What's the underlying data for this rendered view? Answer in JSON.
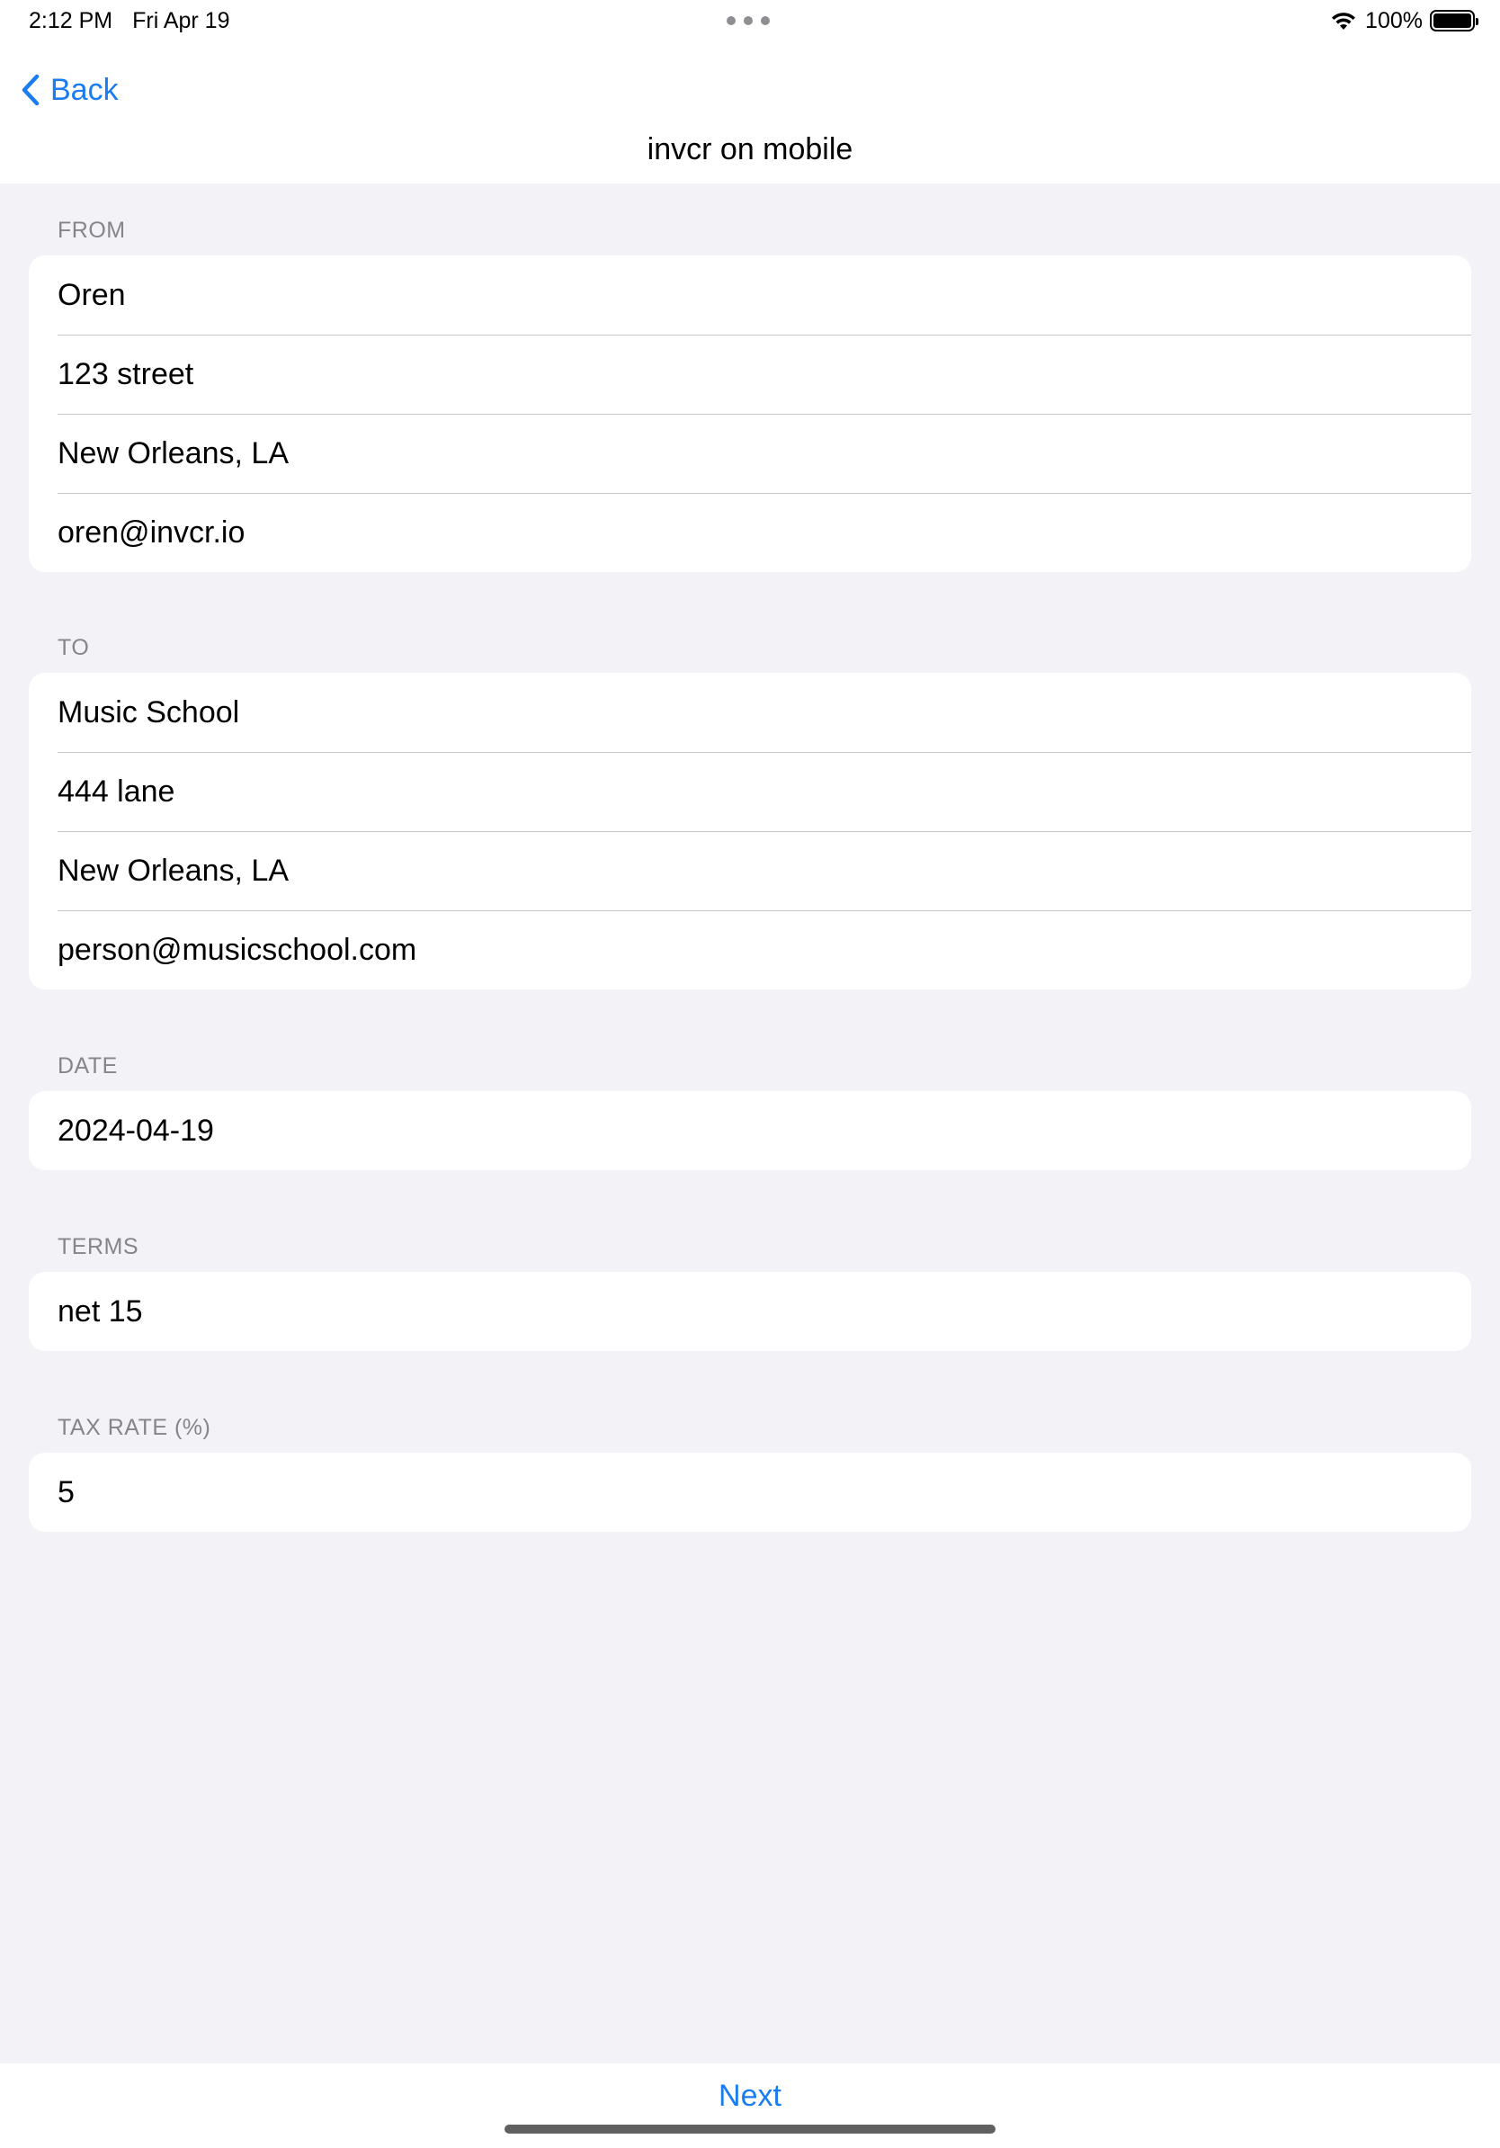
{
  "status_bar": {
    "time": "2:12 PM",
    "date": "Fri Apr 19",
    "battery_text": "100%",
    "battery_level": 1.0,
    "wifi_icon": "wifi-icon",
    "battery_icon": "battery-icon"
  },
  "nav": {
    "back_label": "Back",
    "back_icon": "chevron-left-icon",
    "title": "invcr on mobile"
  },
  "sections": {
    "from": {
      "header": "FROM",
      "name": "Oren",
      "street": "123 street",
      "city": "New Orleans, LA",
      "email": "oren@invcr.io"
    },
    "to": {
      "header": "TO",
      "name": "Music School",
      "street": "444 lane",
      "city": "New Orleans, LA",
      "email": "person@musicschool.com"
    },
    "date": {
      "header": "DATE",
      "value": "2024-04-19"
    },
    "terms": {
      "header": "TERMS",
      "value": "net 15"
    },
    "tax": {
      "header": "TAX RATE (%)",
      "value": "5"
    }
  },
  "toolbar": {
    "next_label": "Next"
  },
  "colors": {
    "accent": "#1A7CF0",
    "background": "#F2F2F7",
    "section_header": "#85858A",
    "separator": "#C6C6C8"
  }
}
